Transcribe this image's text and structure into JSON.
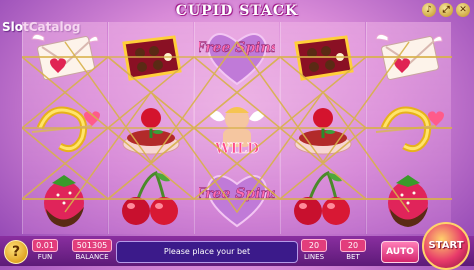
{
  "game": {
    "title": "CUPID STACK",
    "watermark": "SlotCatalog"
  },
  "window_controls": [
    {
      "icon": "sound-icon",
      "glyph": "♪"
    },
    {
      "icon": "fullscreen-icon",
      "glyph": "⤢"
    },
    {
      "icon": "close-icon",
      "glyph": "✕"
    }
  ],
  "reels": [
    [
      "love-letter",
      "cupid-harp",
      "chocolate-strawberry"
    ],
    [
      "chocolate-box",
      "rose-cake",
      "cherries"
    ],
    [
      "free-spins",
      "cupid-wild",
      "free-spins"
    ],
    [
      "chocolate-box",
      "rose-cake",
      "cherries"
    ],
    [
      "love-letter",
      "cupid-harp",
      "chocolate-strawberry"
    ]
  ],
  "symbol_text": {
    "free_spins": "Free Spins",
    "wild": "WILD"
  },
  "bottom": {
    "help_label": "?",
    "fun_value": "0.01",
    "fun_label": "FUN",
    "balance_value": "501305",
    "balance_label": "BALANCE",
    "message": "Please place your bet",
    "lines_value": "20",
    "lines_label": "LINES",
    "bet_value": "20",
    "bet_label": "BET",
    "auto_label": "AUTO",
    "start_label": "START"
  },
  "colors": {
    "accent": "#e23d7c",
    "panel": "#3b1a8a",
    "gold": "#d4a017"
  }
}
